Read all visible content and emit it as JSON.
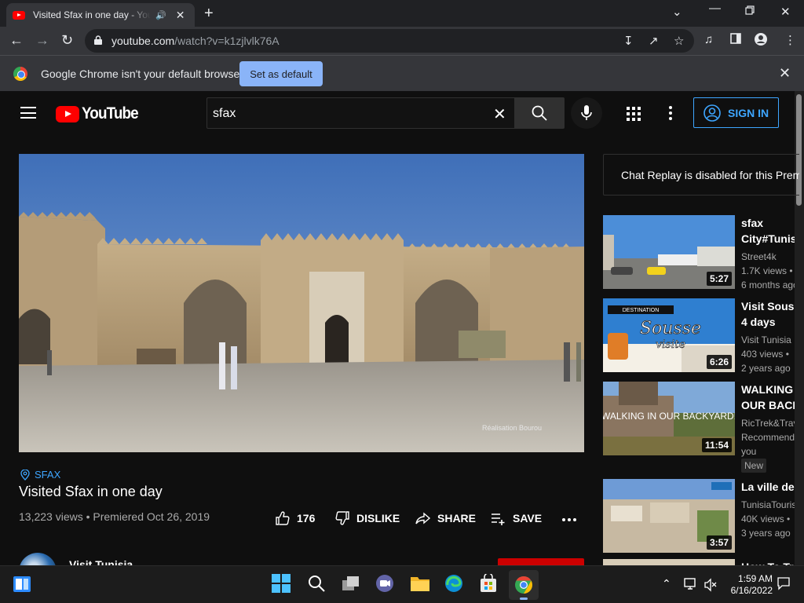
{
  "browser": {
    "tab_title": "Visited Sfax in one day - YouTube",
    "url_domain": "youtube.com",
    "url_path": "/watch?v=k1zjlvlk76A",
    "infobar_message": "Google Chrome isn't your default browser",
    "infobar_button": "Set as default"
  },
  "youtube": {
    "logo_text": "YouTube",
    "search_query": "sfax",
    "sign_in_label": "SIGN IN"
  },
  "video": {
    "hashtag": "SFAX",
    "title": "Visited Sfax in one day",
    "meta": "13,223 views • Premiered Oct 26, 2019",
    "watermark": "Réalisation Bourou",
    "like_count": "176",
    "dislike_label": "DISLIKE",
    "share_label": "SHARE",
    "save_label": "SAVE",
    "channel_name": "Visit Tunisia"
  },
  "chat": {
    "message": "Chat Replay is disabled for this Premiere."
  },
  "related": [
    {
      "title_line1": "sfax",
      "title_line2": "City#Tunisia",
      "channel": "Street4k",
      "views": "1.7K views •",
      "age": "6 months ago",
      "duration": "5:27"
    },
    {
      "title_line1": "Visit Sousse",
      "title_line2": "4 days",
      "channel": "Visit Tunisia",
      "views": "403 views •",
      "age": "2 years ago",
      "duration": "6:26",
      "thumb_caption_small": "DESTINATION",
      "thumb_caption_main": "Sousse",
      "thumb_caption_sub": "visite"
    },
    {
      "title_line1": "WALKING IN",
      "title_line2": "OUR BACKYARD",
      "channel": "RicTrek&Travel",
      "views": "Recommended for",
      "age": "you",
      "badge": "New",
      "duration": "11:54",
      "thumb_caption": "WALKING IN OUR BACKYARD!"
    },
    {
      "title_line1": "La ville de Sfax",
      "channel": "TunisiaTourism",
      "views": "40K views •",
      "age": "3 years ago",
      "duration": "3:57"
    },
    {
      "title_line1": "How To Travel"
    }
  ],
  "system": {
    "time": "1:59 AM",
    "date": "6/16/2022"
  },
  "colors": {
    "youtube_red": "#ff0000",
    "link_blue": "#3ea6ff",
    "chrome_button": "#8ab4f8",
    "page_bg": "#0f0f0f"
  }
}
